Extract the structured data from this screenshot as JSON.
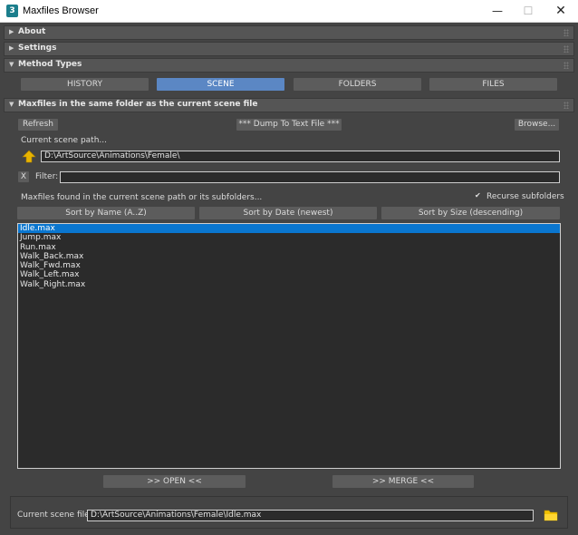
{
  "window": {
    "title": "Maxfiles Browser",
    "icon": "3",
    "min_glyph": "—",
    "max_glyph": "☐",
    "close_glyph": "✕"
  },
  "rollouts": {
    "about": "About",
    "settings": "Settings",
    "method_types": "Method Types",
    "scene_section": "Maxfiles in the same folder as the current scene file"
  },
  "method_tabs": [
    {
      "label": "HISTORY",
      "active": false
    },
    {
      "label": "SCENE",
      "active": true
    },
    {
      "label": "FOLDERS",
      "active": false
    },
    {
      "label": "FILES",
      "active": false
    }
  ],
  "toolbar": {
    "refresh": "Refresh",
    "dump": "*** Dump To Text File ***",
    "browse": "Browse..."
  },
  "scene_path": {
    "label": "Current scene path...",
    "value": "D:\\ArtSource\\Animations\\Female\\"
  },
  "filter": {
    "clear": "X",
    "label": "Filter:",
    "value": ""
  },
  "found_label": "Maxfiles found in the current scene path or its subfolders...",
  "recurse": {
    "label": "Recurse subfolders",
    "checked": true,
    "mark": "✔"
  },
  "sort": {
    "name": "Sort by Name (A..Z)",
    "date": "Sort by Date (newest)",
    "size": "Sort by Size (descending)"
  },
  "files": [
    "Idle.max",
    "Jump.max",
    "Run.max",
    "Walk_Back.max",
    "Walk_Fwd.max",
    "Walk_Left.max",
    "Walk_Right.max"
  ],
  "selected_index": 0,
  "actions": {
    "open": ">>  OPEN  <<",
    "merge": ">>  MERGE  <<"
  },
  "current_file": {
    "label": "Current scene file:",
    "value": "D:\\ArtSource\\Animations\\Female\\Idle.max"
  },
  "colors": {
    "accent": "#5b87c4",
    "selection": "#0a76cf",
    "panel": "#444444",
    "folder": "#f2c200",
    "up_arrow": "#e8b400"
  }
}
